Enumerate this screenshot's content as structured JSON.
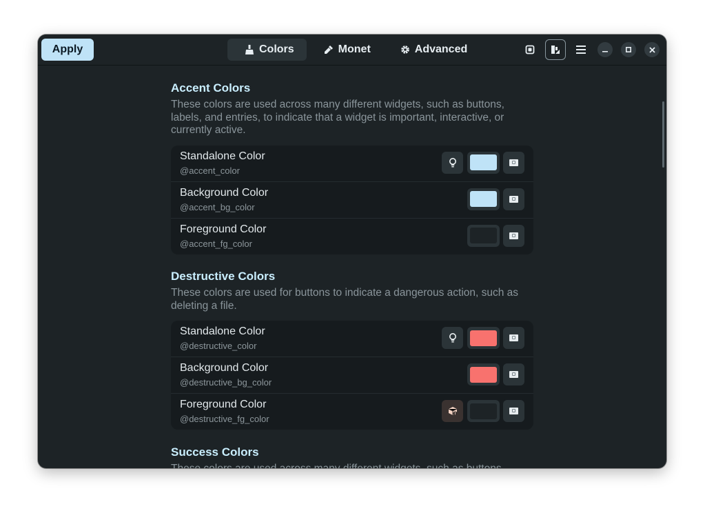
{
  "header": {
    "apply_label": "Apply",
    "tabs": [
      {
        "label": "Colors",
        "icon": "broom-icon",
        "active": true
      },
      {
        "label": "Monet",
        "icon": "dropper-icon",
        "active": false
      },
      {
        "label": "Advanced",
        "icon": "gear-icon",
        "active": false
      }
    ],
    "icons": [
      "phone-preview-icon",
      "theme-toggle-icon",
      "menu-icon",
      "minimize-icon",
      "maximize-icon",
      "close-icon"
    ]
  },
  "sections": [
    {
      "title": "Accent Colors",
      "description": "These colors are used across many different widgets, such as buttons, labels, and entries, to indicate that a widget is important, interactive, or currently active.",
      "rows": [
        {
          "title": "Standalone Color",
          "var": "@accent_color",
          "color": "#bfe3f7",
          "extra": "bulb-icon"
        },
        {
          "title": "Background Color",
          "var": "@accent_bg_color",
          "color": "#bfe3f7",
          "extra": ""
        },
        {
          "title": "Foreground Color",
          "var": "@accent_fg_color",
          "color": "#1d2326",
          "extra": ""
        }
      ]
    },
    {
      "title": "Destructive Colors",
      "description": "These colors are used for buttons to indicate a dangerous action, such as deleting a file.",
      "rows": [
        {
          "title": "Standalone Color",
          "var": "@destructive_color",
          "color": "#f8726e",
          "extra": "bulb-icon"
        },
        {
          "title": "Background Color",
          "var": "@destructive_bg_color",
          "color": "#f8726e",
          "extra": ""
        },
        {
          "title": "Foreground Color",
          "var": "@destructive_fg_color",
          "color": "#1d2326",
          "extra": "warning-box-icon"
        }
      ]
    },
    {
      "title": "Success Colors",
      "description": "These colors are used across many different widgets, such as buttons",
      "rows": []
    }
  ]
}
